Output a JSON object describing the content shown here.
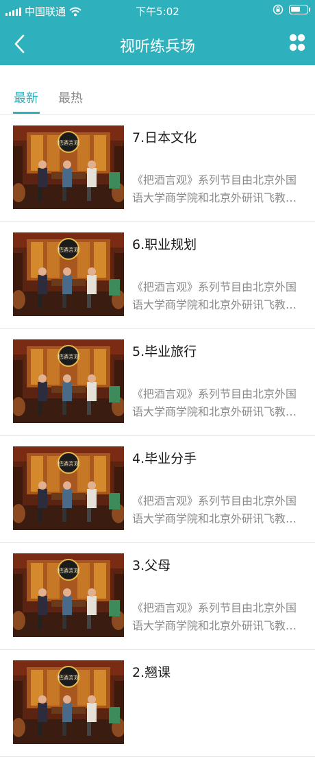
{
  "status": {
    "carrier": "中国联通",
    "time": "下午5:02",
    "battery_level": 0.6
  },
  "header": {
    "title": "视听练兵场"
  },
  "tabs": [
    {
      "label": "最新",
      "active": true
    },
    {
      "label": "最热",
      "active": false
    }
  ],
  "items": [
    {
      "title": "7.日本文化",
      "desc": "《把酒言观》系列节目由北京外国语大学商学院和北京外研讯飞教学与研究…"
    },
    {
      "title": "6.职业规划",
      "desc": "《把酒言观》系列节目由北京外国语大学商学院和北京外研讯飞教学与研究…"
    },
    {
      "title": "5.毕业旅行",
      "desc": "《把酒言观》系列节目由北京外国语大学商学院和北京外研讯飞教学与研究…"
    },
    {
      "title": "4.毕业分手",
      "desc": "《把酒言观》系列节目由北京外国语大学商学院和北京外研讯飞教学与研究…"
    },
    {
      "title": "3.父母",
      "desc": "《把酒言观》系列节目由北京外国语大学商学院和北京外研讯飞教学与研究…"
    },
    {
      "title": "2.翘课",
      "desc": ""
    }
  ],
  "thumbnail": {
    "logo_text": "把酒言观"
  },
  "colors": {
    "accent": "#2fb0bd",
    "text": "#1a1a1a",
    "muted": "#8a8a8a",
    "divider": "#e6e6e6"
  },
  "icons": {
    "back": "chevron-left-icon",
    "menu": "grid-icon",
    "wifi": "wifi-icon",
    "lock": "rotation-lock-icon",
    "battery": "battery-icon"
  }
}
